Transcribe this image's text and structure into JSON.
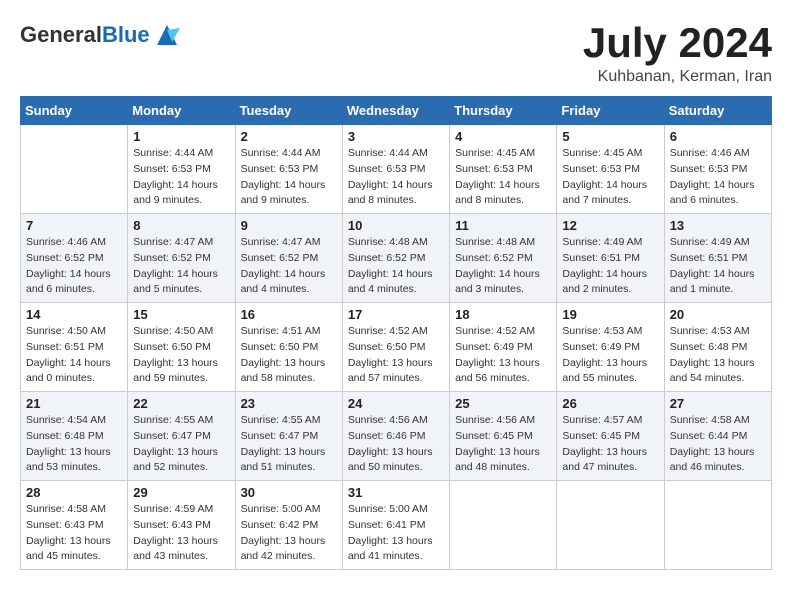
{
  "header": {
    "logo_line1": "General",
    "logo_line2": "Blue",
    "month": "July 2024",
    "location": "Kuhbanan, Kerman, Iran"
  },
  "weekdays": [
    "Sunday",
    "Monday",
    "Tuesday",
    "Wednesday",
    "Thursday",
    "Friday",
    "Saturday"
  ],
  "weeks": [
    [
      {
        "day": "",
        "info": ""
      },
      {
        "day": "1",
        "info": "Sunrise: 4:44 AM\nSunset: 6:53 PM\nDaylight: 14 hours\nand 9 minutes."
      },
      {
        "day": "2",
        "info": "Sunrise: 4:44 AM\nSunset: 6:53 PM\nDaylight: 14 hours\nand 9 minutes."
      },
      {
        "day": "3",
        "info": "Sunrise: 4:44 AM\nSunset: 6:53 PM\nDaylight: 14 hours\nand 8 minutes."
      },
      {
        "day": "4",
        "info": "Sunrise: 4:45 AM\nSunset: 6:53 PM\nDaylight: 14 hours\nand 8 minutes."
      },
      {
        "day": "5",
        "info": "Sunrise: 4:45 AM\nSunset: 6:53 PM\nDaylight: 14 hours\nand 7 minutes."
      },
      {
        "day": "6",
        "info": "Sunrise: 4:46 AM\nSunset: 6:53 PM\nDaylight: 14 hours\nand 6 minutes."
      }
    ],
    [
      {
        "day": "7",
        "info": "Sunrise: 4:46 AM\nSunset: 6:52 PM\nDaylight: 14 hours\nand 6 minutes."
      },
      {
        "day": "8",
        "info": "Sunrise: 4:47 AM\nSunset: 6:52 PM\nDaylight: 14 hours\nand 5 minutes."
      },
      {
        "day": "9",
        "info": "Sunrise: 4:47 AM\nSunset: 6:52 PM\nDaylight: 14 hours\nand 4 minutes."
      },
      {
        "day": "10",
        "info": "Sunrise: 4:48 AM\nSunset: 6:52 PM\nDaylight: 14 hours\nand 4 minutes."
      },
      {
        "day": "11",
        "info": "Sunrise: 4:48 AM\nSunset: 6:52 PM\nDaylight: 14 hours\nand 3 minutes."
      },
      {
        "day": "12",
        "info": "Sunrise: 4:49 AM\nSunset: 6:51 PM\nDaylight: 14 hours\nand 2 minutes."
      },
      {
        "day": "13",
        "info": "Sunrise: 4:49 AM\nSunset: 6:51 PM\nDaylight: 14 hours\nand 1 minute."
      }
    ],
    [
      {
        "day": "14",
        "info": "Sunrise: 4:50 AM\nSunset: 6:51 PM\nDaylight: 14 hours\nand 0 minutes."
      },
      {
        "day": "15",
        "info": "Sunrise: 4:50 AM\nSunset: 6:50 PM\nDaylight: 13 hours\nand 59 minutes."
      },
      {
        "day": "16",
        "info": "Sunrise: 4:51 AM\nSunset: 6:50 PM\nDaylight: 13 hours\nand 58 minutes."
      },
      {
        "day": "17",
        "info": "Sunrise: 4:52 AM\nSunset: 6:50 PM\nDaylight: 13 hours\nand 57 minutes."
      },
      {
        "day": "18",
        "info": "Sunrise: 4:52 AM\nSunset: 6:49 PM\nDaylight: 13 hours\nand 56 minutes."
      },
      {
        "day": "19",
        "info": "Sunrise: 4:53 AM\nSunset: 6:49 PM\nDaylight: 13 hours\nand 55 minutes."
      },
      {
        "day": "20",
        "info": "Sunrise: 4:53 AM\nSunset: 6:48 PM\nDaylight: 13 hours\nand 54 minutes."
      }
    ],
    [
      {
        "day": "21",
        "info": "Sunrise: 4:54 AM\nSunset: 6:48 PM\nDaylight: 13 hours\nand 53 minutes."
      },
      {
        "day": "22",
        "info": "Sunrise: 4:55 AM\nSunset: 6:47 PM\nDaylight: 13 hours\nand 52 minutes."
      },
      {
        "day": "23",
        "info": "Sunrise: 4:55 AM\nSunset: 6:47 PM\nDaylight: 13 hours\nand 51 minutes."
      },
      {
        "day": "24",
        "info": "Sunrise: 4:56 AM\nSunset: 6:46 PM\nDaylight: 13 hours\nand 50 minutes."
      },
      {
        "day": "25",
        "info": "Sunrise: 4:56 AM\nSunset: 6:45 PM\nDaylight: 13 hours\nand 48 minutes."
      },
      {
        "day": "26",
        "info": "Sunrise: 4:57 AM\nSunset: 6:45 PM\nDaylight: 13 hours\nand 47 minutes."
      },
      {
        "day": "27",
        "info": "Sunrise: 4:58 AM\nSunset: 6:44 PM\nDaylight: 13 hours\nand 46 minutes."
      }
    ],
    [
      {
        "day": "28",
        "info": "Sunrise: 4:58 AM\nSunset: 6:43 PM\nDaylight: 13 hours\nand 45 minutes."
      },
      {
        "day": "29",
        "info": "Sunrise: 4:59 AM\nSunset: 6:43 PM\nDaylight: 13 hours\nand 43 minutes."
      },
      {
        "day": "30",
        "info": "Sunrise: 5:00 AM\nSunset: 6:42 PM\nDaylight: 13 hours\nand 42 minutes."
      },
      {
        "day": "31",
        "info": "Sunrise: 5:00 AM\nSunset: 6:41 PM\nDaylight: 13 hours\nand 41 minutes."
      },
      {
        "day": "",
        "info": ""
      },
      {
        "day": "",
        "info": ""
      },
      {
        "day": "",
        "info": ""
      }
    ]
  ]
}
